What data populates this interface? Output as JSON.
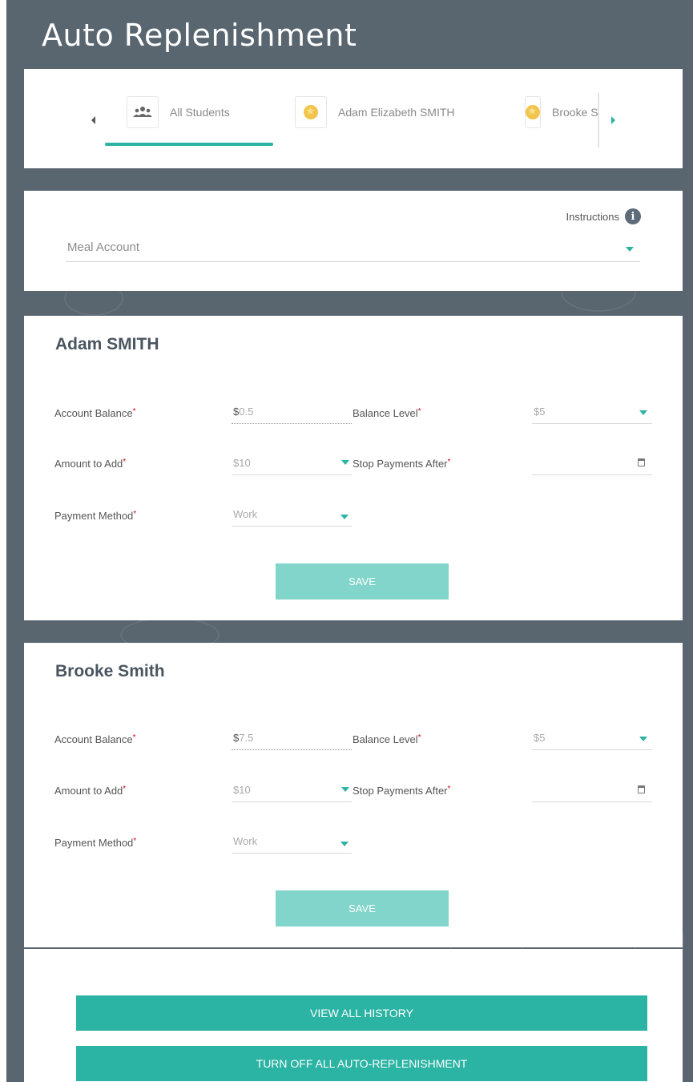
{
  "page": {
    "title": "Auto Replenishment"
  },
  "tabs": [
    {
      "label": "All Students",
      "icon": "users-icon"
    },
    {
      "label": "Adam Elizabeth SMITH",
      "icon": "star-avatar-icon"
    },
    {
      "label": "Brooke Smith",
      "icon": "star-avatar-icon"
    }
  ],
  "meal": {
    "instructions_label": "Instructions",
    "account_select": "Meal Account"
  },
  "students": [
    {
      "name": "Adam SMITH",
      "account_balance_label": "Account Balance",
      "account_balance_currency": "$",
      "account_balance_value": "0.5",
      "balance_level_label": "Balance Level",
      "balance_level_value": "$5",
      "amount_to_add_label": "Amount to Add",
      "amount_to_add_value": "$10",
      "stop_payments_label": "Stop Payments After",
      "stop_payments_value": "",
      "payment_method_label": "Payment Method",
      "payment_method_value": "Work",
      "save_label": "SAVE"
    },
    {
      "name": "Brooke Smith",
      "account_balance_label": "Account Balance",
      "account_balance_currency": "$",
      "account_balance_value": "7.5",
      "balance_level_label": "Balance Level",
      "balance_level_value": "$5",
      "amount_to_add_label": "Amount to Add",
      "amount_to_add_value": "$10",
      "stop_payments_label": "Stop Payments After",
      "stop_payments_value": "",
      "payment_method_label": "Payment Method",
      "payment_method_value": "Work",
      "save_label": "SAVE"
    }
  ],
  "actions": {
    "view_history": "VIEW ALL HISTORY",
    "turn_off": "TURN OFF ALL AUTO-REPLENISHMENT"
  },
  "colors": {
    "background": "#596670",
    "accent": "#2bb3a3",
    "save_button": "#82d5ca",
    "required": "#d0021b"
  }
}
